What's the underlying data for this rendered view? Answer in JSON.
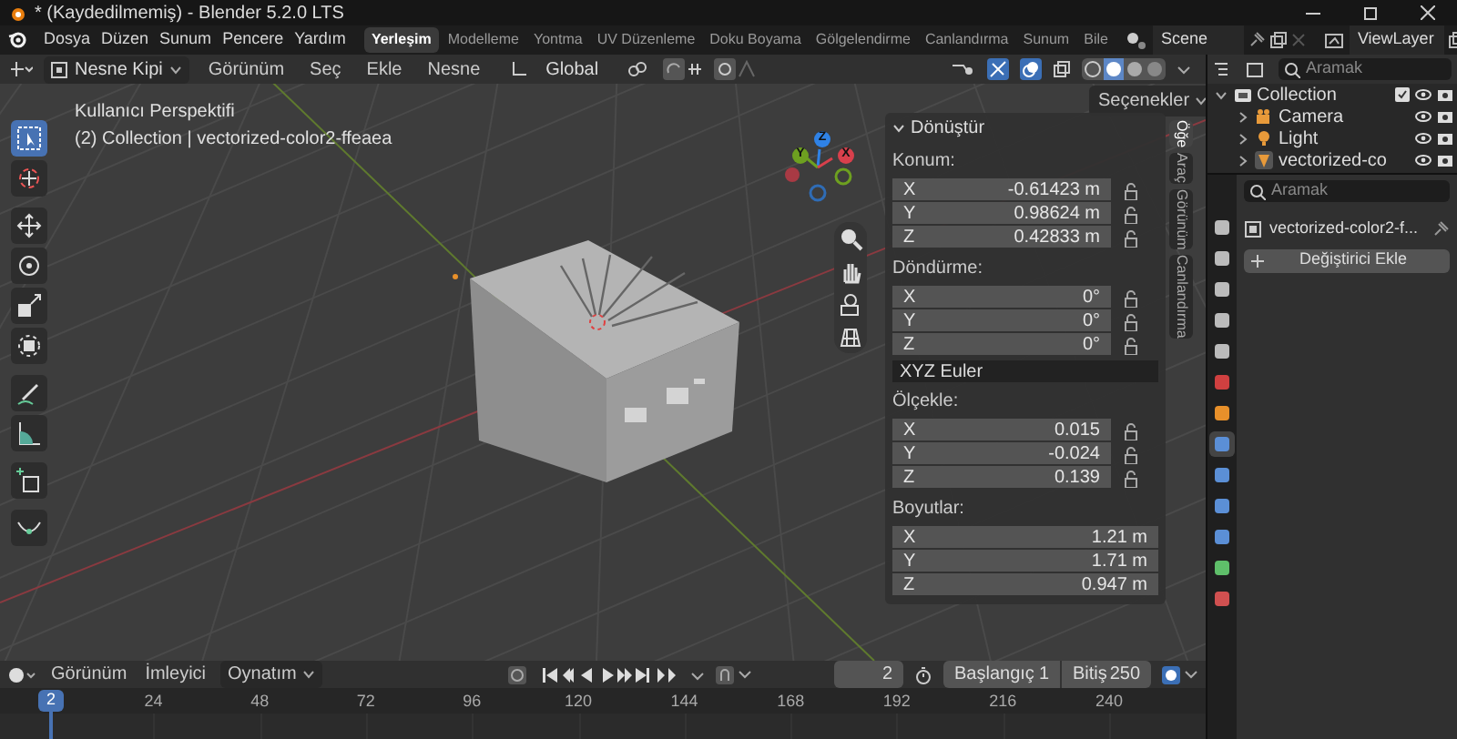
{
  "window": {
    "title": "* (Kaydedilmemiş) - Blender 5.2.0 LTS"
  },
  "menu": [
    "Dosya",
    "Düzen",
    "Sunum",
    "Pencere",
    "Yardım"
  ],
  "workspaces": [
    {
      "label": "Yerleşim",
      "selected": true
    },
    {
      "label": "Modelleme",
      "selected": false
    },
    {
      "label": "Yontma",
      "selected": false
    },
    {
      "label": "UV Düzenleme",
      "selected": false
    },
    {
      "label": "Doku Boyama",
      "selected": false
    },
    {
      "label": "Gölgelendirme",
      "selected": false
    },
    {
      "label": "Canlandırma",
      "selected": false
    },
    {
      "label": "Sunum",
      "selected": false
    },
    {
      "label": "Bile",
      "selected": false
    }
  ],
  "scene": "Scene",
  "view_layer": "ViewLayer",
  "viewport_header": {
    "mode": "Nesne Kipi",
    "menus": [
      "Görünüm",
      "Seç",
      "Ekle",
      "Nesne"
    ],
    "orientation": "Global",
    "options": "Seçenekler"
  },
  "viewport": {
    "view_name": "Kullanıcı Perspektifi",
    "context": "(2) Collection | vectorized-color2-ffeaea",
    "tools": [
      {
        "kind": "select",
        "selected": true
      },
      {
        "kind": "cursor",
        "selected": false
      },
      {
        "kind": "move",
        "selected": false
      },
      {
        "kind": "rotate",
        "selected": false
      },
      {
        "kind": "scale",
        "selected": false
      },
      {
        "kind": "transform",
        "selected": false
      },
      {
        "kind": "annotate",
        "selected": false
      },
      {
        "kind": "measure",
        "selected": false
      },
      {
        "kind": "add",
        "selected": false
      },
      {
        "kind": "curve",
        "selected": false
      }
    ],
    "axes": [
      {
        "label": "Z",
        "color": "#2f82e6"
      },
      {
        "label": "Y",
        "color": "#6ea020"
      },
      {
        "label": "X",
        "color": "#d8404c"
      }
    ]
  },
  "sidebar": {
    "title": "Dönüştür",
    "groups": [
      {
        "label": "Konum:",
        "rows": [
          {
            "axis": "X",
            "value": "-0.61423 m"
          },
          {
            "axis": "Y",
            "value": "0.98624 m"
          },
          {
            "axis": "Z",
            "value": "0.42833 m"
          }
        ],
        "locks": true
      },
      {
        "label": "Döndürme:",
        "rows": [
          {
            "axis": "X",
            "value": "0°"
          },
          {
            "axis": "Y",
            "value": "0°"
          },
          {
            "axis": "Z",
            "value": "0°"
          }
        ],
        "locks": true,
        "mode": "XYZ Euler"
      },
      {
        "label": "Ölçekle:",
        "rows": [
          {
            "axis": "X",
            "value": "0.015"
          },
          {
            "axis": "Y",
            "value": "-0.024"
          },
          {
            "axis": "Z",
            "value": "0.139"
          }
        ],
        "locks": true
      },
      {
        "label": "Boyutlar:",
        "rows": [
          {
            "axis": "X",
            "value": "1.21 m"
          },
          {
            "axis": "Y",
            "value": "1.71 m"
          },
          {
            "axis": "Z",
            "value": "0.947 m"
          }
        ],
        "locks": false
      }
    ],
    "tabs": [
      {
        "label": "Öğe",
        "selected": true
      },
      {
        "label": "Araç",
        "selected": false
      },
      {
        "label": "Görünüm",
        "selected": false
      },
      {
        "label": "Canlandırma",
        "selected": false
      }
    ]
  },
  "outliner": {
    "search_placeholder": "Aramak",
    "tree": [
      {
        "label": "Collection",
        "kind": "collection",
        "expanded": true,
        "children": [
          {
            "label": "Camera",
            "kind": "camera",
            "expanded": false
          },
          {
            "label": "Light",
            "kind": "light",
            "expanded": false
          },
          {
            "label": "vectorized-co",
            "kind": "mesh",
            "expanded": false
          }
        ]
      }
    ]
  },
  "properties": {
    "search_placeholder": "Aramak",
    "object": "vectorized-color2-f...",
    "add_button": "Değiştirici Ekle",
    "tabs": [
      {
        "kind": "tool",
        "selected": false
      },
      {
        "kind": "render",
        "selected": false
      },
      {
        "kind": "output",
        "selected": false
      },
      {
        "kind": "view",
        "selected": false
      },
      {
        "kind": "scene",
        "selected": false
      },
      {
        "kind": "world",
        "selected": false
      },
      {
        "kind": "object",
        "selected": false
      },
      {
        "kind": "modifier",
        "selected": true
      },
      {
        "kind": "particles",
        "selected": false
      },
      {
        "kind": "physics",
        "selected": false
      },
      {
        "kind": "constraint",
        "selected": false
      },
      {
        "kind": "data",
        "selected": false
      },
      {
        "kind": "material",
        "selected": false
      }
    ]
  },
  "timeline": {
    "menus": [
      {
        "label": "Görünüm",
        "kind": "menu"
      },
      {
        "label": "İmleyici",
        "kind": "menu"
      },
      {
        "label": "Oynatım",
        "kind": "dropdown"
      }
    ],
    "current_frame": "2",
    "start_label": "Başlangıç",
    "start": "1",
    "end_label": "Bitiş",
    "end": "250",
    "playhead": "2",
    "ticks": [
      "24",
      "48",
      "72",
      "96",
      "120",
      "144",
      "168",
      "192",
      "216",
      "240"
    ]
  }
}
